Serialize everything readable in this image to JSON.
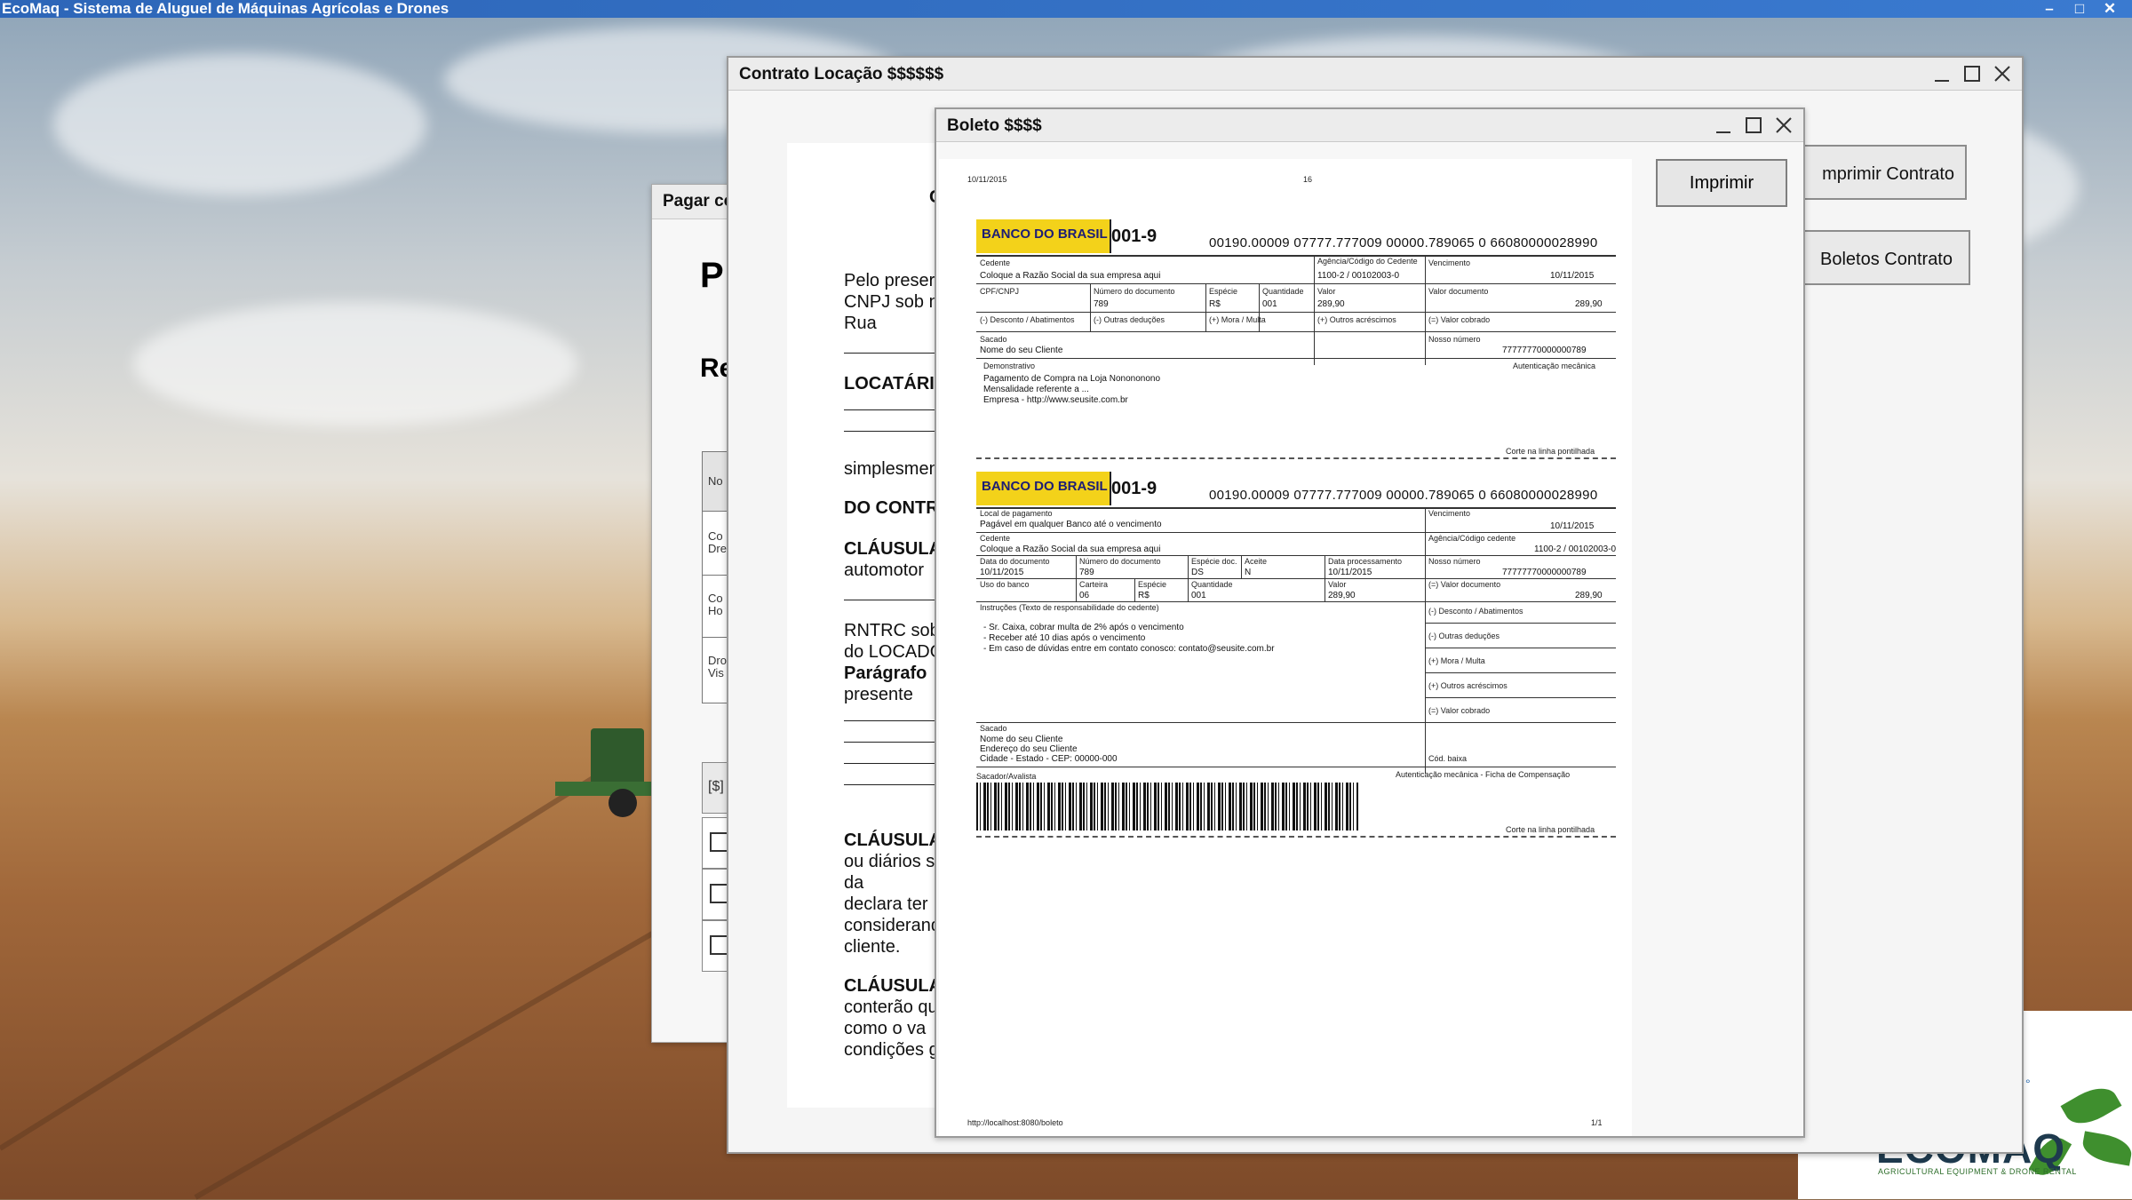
{
  "app": {
    "title": "EcoMaq - Sistema de Aluguel de Máquinas Agrícolas e Drones"
  },
  "pagar_window": {
    "title": "Pagar co",
    "heading": "P",
    "subheading": "Re",
    "table": {
      "header": "No",
      "rows": [
        "Co\nDre",
        "Co\nHo",
        "Dro\nVis"
      ]
    },
    "sum_label": "[$]"
  },
  "contrato_window": {
    "title": "Contrato Locação $$$$$$",
    "doc_title": "C",
    "lines": [
      "Pelo preser",
      "CNPJ sob n",
      "Rua",
      "LOCATÁRI",
      "simplesmen",
      "DO CONTR",
      "CLÁUSULA",
      "automotor",
      "RNTRC sob",
      "do LOCADO",
      "Parágrafo",
      "presente",
      "CLÁUSULA",
      "ou diários s",
      "da",
      "declara ter",
      "considerand",
      "cliente.",
      "CLÁUSULA",
      "conterão qu",
      "como o va",
      "condições g"
    ],
    "btn_print_contract": "mprimir Contrato",
    "btn_boletos_contract": "Boletos Contrato"
  },
  "boleto_window": {
    "title": "Boleto $$$$",
    "print_button": "Imprimir",
    "page_date": "10/11/2015",
    "page_num_top": "16",
    "footer_url": "http://localhost:8080/boleto",
    "footer_page": "1/1",
    "bank_name": "BANCO DO BRASIL",
    "bank_code": "001-9",
    "digitable_line": "00190.00009 07777.777009 00000.789065 0 66080000028990",
    "slip1": {
      "cedente_label": "Cedente",
      "cedente_value": "Coloque a Razão Social da sua empresa aqui",
      "agencia_label": "Agência/Código do Cedente",
      "agencia_value": "1100-2 / 00102003-0",
      "vencimento_label": "Vencimento",
      "vencimento_value": "10/11/2015",
      "cpf_label": "CPF/CNPJ",
      "num_doc_label": "Número do documento",
      "num_doc_value": "789",
      "especie_label": "Espécie",
      "especie_value": "R$",
      "quantidade_label": "Quantidade",
      "quantidade_value": "001",
      "valor_label": "Valor",
      "valor_value": "289,90",
      "valor_doc_label": "Valor documento",
      "valor_doc_value": "289,90",
      "desconto_label": "(-) Desconto / Abatimentos",
      "deducoes_label": "(-) Outras deduções",
      "mora_label": "(+) Mora / Multa",
      "acrescimos_label": "(+) Outros acréscimos",
      "cobrado_label": "(=) Valor cobrado",
      "sacado_label": "Sacado",
      "sacado_value": "Nome do seu Cliente",
      "nosso_label": "Nosso número",
      "nosso_value": "77777770000000789",
      "demonstrativo_label": "Demonstrativo",
      "demonstrativo_lines": [
        "Pagamento de Compra na Loja Nonononono",
        "Mensalidade referente a ...",
        "Empresa - http://www.seusite.com.br"
      ],
      "autenticacao": "Autenticação mecânica",
      "corte": "Corte na linha pontilhada"
    },
    "slip2": {
      "local_label": "Local de pagamento",
      "local_value": "Pagável em qualquer Banco até o vencimento",
      "vencimento_label": "Vencimento",
      "vencimento_value": "10/11/2015",
      "cedente_label": "Cedente",
      "cedente_value": "Coloque a Razão Social da sua empresa aqui",
      "agencia_label": "Agência/Código cedente",
      "agencia_value": "1100-2 / 00102003-0",
      "data_doc_label": "Data do documento",
      "data_doc_value": "10/11/2015",
      "num_doc_label": "Número do documento",
      "num_doc_value": "789",
      "especie_doc_label": "Espécie doc.",
      "especie_doc_value": "DS",
      "aceite_label": "Aceite",
      "aceite_value": "N",
      "data_proc_label": "Data processamento",
      "data_proc_value": "10/11/2015",
      "nosso_label": "Nosso número",
      "nosso_value": "77777770000000789",
      "uso_banco_label": "Uso do banco",
      "carteira_label": "Carteira",
      "carteira_value": "06",
      "especie_label": "Espécie",
      "especie_value": "R$",
      "quantidade_label": "Quantidade",
      "quantidade_value": "001",
      "valor_label": "Valor",
      "valor_value": "289,90",
      "valor_doc_label": "(=) Valor documento",
      "valor_doc_value": "289,90",
      "instrucoes_label": "Instruções (Texto de responsabilidade do cedente)",
      "instrucoes_lines": [
        "- Sr. Caixa, cobrar multa de 2% após o vencimento",
        "- Receber até 10 dias após o vencimento",
        "- Em caso de dúvidas entre em contato conosco: contato@seusite.com.br"
      ],
      "desconto_label": "(-) Desconto / Abatimentos",
      "deducoes_label": "(-) Outras deduções",
      "mora_label": "(+) Mora / Multa",
      "acrescimos_label": "(+) Outros acréscimos",
      "cobrado_label": "(=) Valor cobrado",
      "sacado_label": "Sacado",
      "sacado_lines": [
        "Nome do seu Cliente",
        "Endereço do seu Cliente",
        "Cidade - Estado - CEP: 00000-000"
      ],
      "cod_baixa_label": "Cód. baixa",
      "sacador_label": "Sacador/Avalista",
      "autenticacao": "Autenticação mecânica - Ficha de Compensação",
      "corte": "Corte na linha pontilhada"
    }
  },
  "brand": {
    "name": "ECOMAQ",
    "tagline": "AGRICULTURAL EQUIPMENT & DRONE RENTAL",
    "colors": {
      "primary": "#1e3a4e",
      "leaf": "#3f8f2e",
      "bank_yellow": "#f3d21a",
      "titlebar": "#2d66b8"
    }
  }
}
